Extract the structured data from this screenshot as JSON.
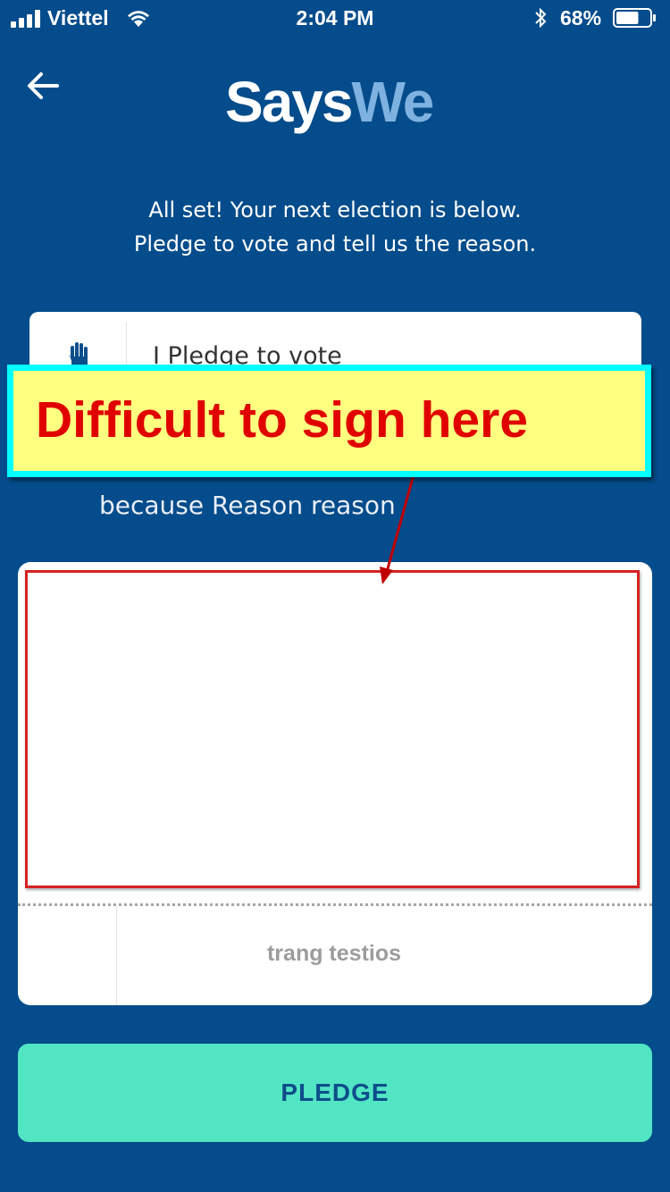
{
  "status_bar": {
    "carrier": "Viettel",
    "time": "2:04 PM",
    "battery_percent": "68%",
    "battery_level": 0.68,
    "icons": [
      "signal-icon",
      "wifi-icon",
      "bluetooth-icon",
      "battery-icon"
    ]
  },
  "header": {
    "back_icon": "back-arrow-icon",
    "logo_part1": "Says",
    "logo_part2": "We"
  },
  "intro": {
    "line1": "All set! Your next election is below.",
    "line2": "Pledge to vote and tell us the reason."
  },
  "pledge_card": {
    "icon": "raised-hand-icon",
    "text": "I Pledge to vote"
  },
  "reason_text": "because Reason reason",
  "signature": {
    "name": "trang testios"
  },
  "annotation": {
    "callout_text": "Difficult to sign here",
    "colors": {
      "callout_fill": "#ffff80",
      "callout_border": "#00ffff",
      "text": "#e00000",
      "highlight": "#d42222"
    }
  },
  "buttons": {
    "pledge_label": "PLEDGE"
  },
  "colors": {
    "background": "#044c8b",
    "accent_button": "#51e5c3",
    "logo_we": "#7fb2e0"
  }
}
